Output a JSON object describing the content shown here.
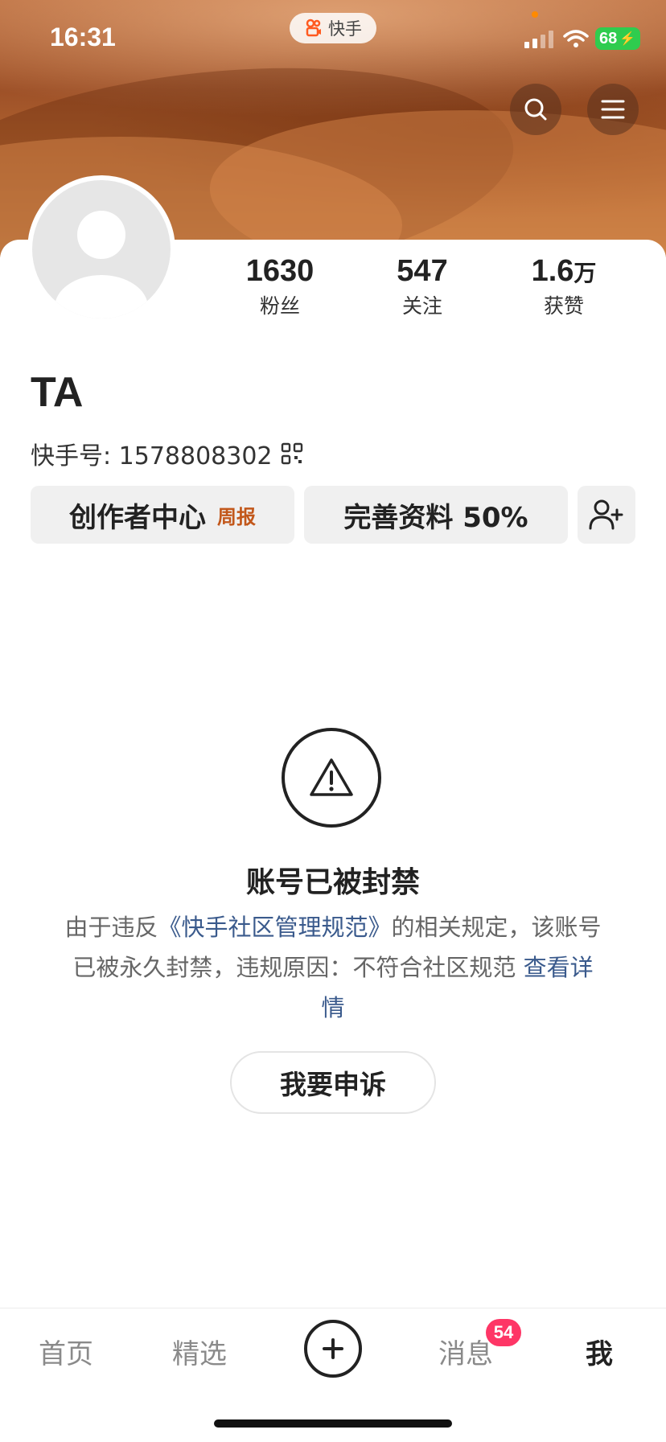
{
  "status_bar": {
    "time": "16:31",
    "battery": "68",
    "app_name": "快手"
  },
  "header": {
    "search_icon": "search-icon",
    "menu_icon": "menu-icon"
  },
  "profile": {
    "stats": [
      {
        "value": "1630",
        "unit": "",
        "label": "粉丝"
      },
      {
        "value": "547",
        "unit": "",
        "label": "关注"
      },
      {
        "value": "1.6",
        "unit": "万",
        "label": "获赞"
      }
    ],
    "name": "TA",
    "kuaishou_id": "快手号: 1578808302",
    "buttons": {
      "creator_center": "创作者中心",
      "weekly_report": "周报",
      "complete_profile": "完善资料 50%"
    }
  },
  "banned": {
    "title": "账号已被封禁",
    "text_before": "由于违反",
    "link_rules": "《快手社区管理规范》",
    "text_after": "的相关规定，该账号已被永久封禁，违规原因：不符合社区规范",
    "link_details": "查看详情",
    "appeal_button": "我要申诉"
  },
  "tabbar": {
    "home": "首页",
    "featured": "精选",
    "messages": "消息",
    "messages_badge": "54",
    "me": "我"
  },
  "colors": {
    "link": "#3a5a8c",
    "badge": "#fe3666",
    "weekly": "#c2571a",
    "battery": "#2fcc4e"
  }
}
